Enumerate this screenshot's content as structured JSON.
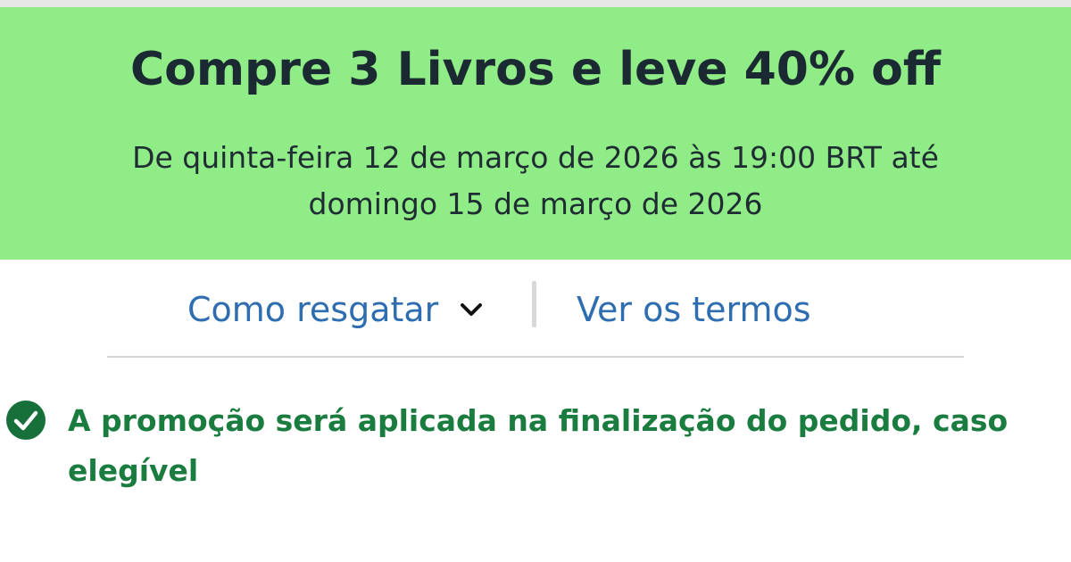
{
  "banner": {
    "title": "Compre 3 Livros e leve 40% off",
    "dates": "De quinta-feira 12 de março de 2026 às 19:00 BRT até domingo 15 de março de 2026",
    "background_color": "#90ec86"
  },
  "links": {
    "redeem_label": "Como resgatar",
    "redeem_icon": "chevron-down-icon",
    "terms_label": "Ver os termos",
    "link_color": "#2d6db0"
  },
  "notice": {
    "icon": "checkmark-circle-icon",
    "text": "A promoção será aplicada na finalização do pedido, caso elegível",
    "color": "#1a7d3f"
  }
}
